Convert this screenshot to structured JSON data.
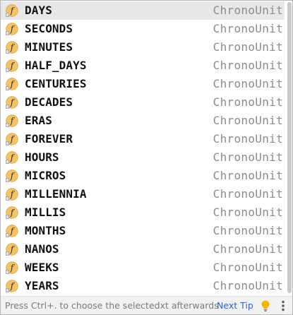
{
  "completion_popup": {
    "items": [
      {
        "name": "DAYS",
        "type": "ChronoUnit",
        "icon": "field-icon",
        "selected": true
      },
      {
        "name": "SECONDS",
        "type": "ChronoUnit",
        "icon": "field-icon"
      },
      {
        "name": "MINUTES",
        "type": "ChronoUnit",
        "icon": "field-icon"
      },
      {
        "name": "HALF_DAYS",
        "type": "ChronoUnit",
        "icon": "field-icon"
      },
      {
        "name": "CENTURIES",
        "type": "ChronoUnit",
        "icon": "field-icon"
      },
      {
        "name": "DECADES",
        "type": "ChronoUnit",
        "icon": "field-icon"
      },
      {
        "name": "ERAS",
        "type": "ChronoUnit",
        "icon": "field-icon"
      },
      {
        "name": "FOREVER",
        "type": "ChronoUnit",
        "icon": "field-icon"
      },
      {
        "name": "HOURS",
        "type": "ChronoUnit",
        "icon": "field-icon"
      },
      {
        "name": "MICROS",
        "type": "ChronoUnit",
        "icon": "field-icon"
      },
      {
        "name": "MILLENNIA",
        "type": "ChronoUnit",
        "icon": "field-icon"
      },
      {
        "name": "MILLIS",
        "type": "ChronoUnit",
        "icon": "field-icon"
      },
      {
        "name": "MONTHS",
        "type": "ChronoUnit",
        "icon": "field-icon"
      },
      {
        "name": "NANOS",
        "type": "ChronoUnit",
        "icon": "field-icon"
      },
      {
        "name": "WEEKS",
        "type": "ChronoUnit",
        "icon": "field-icon"
      },
      {
        "name": "YEARS",
        "type": "ChronoUnit",
        "icon": "field-icon"
      }
    ],
    "icon_letter": "f",
    "footer": {
      "hint": "Press Ctrl+. to choose the selectedxt afterwards",
      "next_tip": "Next Tip",
      "bulb_icon": "lightbulb-icon",
      "menu_icon": "more-vertical-icon"
    },
    "colors": {
      "selected_row": "#e8e8e8",
      "type_text": "#8c8c8c",
      "link": "#2f65ca",
      "icon_fill": "#f6c36a",
      "bulb": "#f2b705"
    }
  }
}
